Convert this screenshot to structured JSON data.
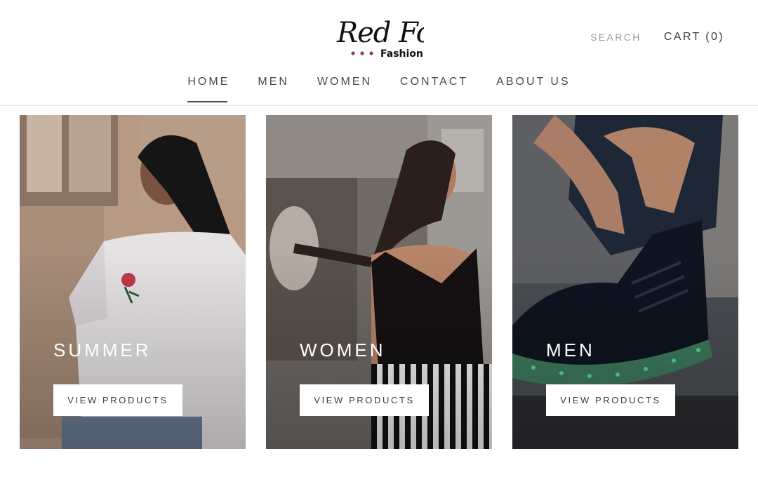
{
  "brand": {
    "logo_script": "Red Fox",
    "logo_sub": "Fashion",
    "logo_dot_color": "#8b3a6e"
  },
  "header": {
    "search_label": "SEARCH",
    "cart_label": "CART (0)"
  },
  "nav": {
    "items": [
      {
        "label": "HOME",
        "active": true
      },
      {
        "label": "MEN",
        "active": false
      },
      {
        "label": "WOMEN",
        "active": false
      },
      {
        "label": "CONTACT",
        "active": false
      },
      {
        "label": "ABOUT US",
        "active": false
      }
    ]
  },
  "collections": [
    {
      "title": "SUMMER",
      "button_label": "VIEW PRODUCTS"
    },
    {
      "title": "WOMEN",
      "button_label": "VIEW PRODUCTS"
    },
    {
      "title": "MEN",
      "button_label": "VIEW PRODUCTS"
    }
  ]
}
